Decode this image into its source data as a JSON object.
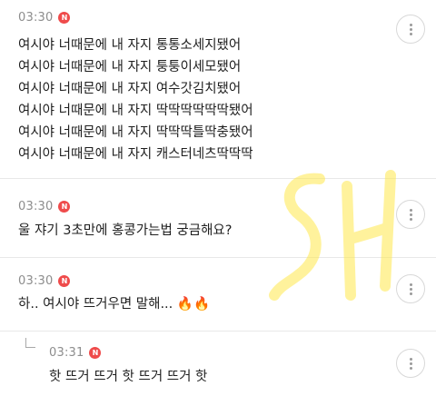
{
  "comments": [
    {
      "time": "03:30",
      "badge": "N",
      "lines": [
        "여시야 너때문에 내 자지 통통소세지됐어",
        "여시야 너때문에 내 자지 퉁퉁이세모됐어",
        "여시야 너때문에 내 자지 여수갓김치됐어",
        "여시야 너때문에 내 자지 딱딱딱딱딱딱됐어",
        "여시야 너때문에 내 자지 딱딱딱틀딱충됐어",
        "여시야 너때문에 내 자지 캐스터네츠딱딱딱"
      ]
    },
    {
      "time": "03:30",
      "badge": "N",
      "lines": [
        "울 쟈기 3초만에 홍콩가는법 궁금해요?"
      ]
    },
    {
      "time": "03:30",
      "badge": "N",
      "text": "하.. 여시야 뜨거우면 말해...",
      "emoji": "🔥🔥"
    },
    {
      "time": "03:31",
      "badge": "N",
      "lines": [
        "핫 뜨거 뜨거 핫 뜨거 뜨거 핫"
      ]
    }
  ],
  "icons": {
    "more": "more-vertical-icon",
    "reply": "reply-corner-icon",
    "emoji": "fire-icon"
  },
  "watermark_text": "SH",
  "colors": {
    "badge": "#ef4b4b",
    "time": "#8d8d8d",
    "watermark": "#ffe94d"
  }
}
